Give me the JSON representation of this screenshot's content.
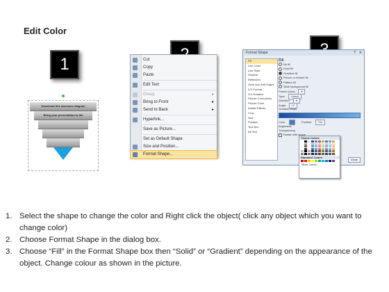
{
  "title": "Edit Color",
  "badges": [
    "1",
    "2",
    "3"
  ],
  "pyramid": {
    "layers": [
      "Download this awesome diagram",
      "Bring your presentation to life",
      "",
      "",
      ""
    ],
    "accent_color": "#1e9fe0"
  },
  "context_menu": {
    "items": [
      {
        "label": "Cut",
        "state": "normal"
      },
      {
        "label": "Copy",
        "state": "normal"
      },
      {
        "label": "Paste",
        "state": "normal"
      },
      {
        "label": "Edit Text",
        "state": "normal"
      },
      {
        "label": "Group",
        "state": "disabled"
      },
      {
        "label": "Bring to Front",
        "state": "normal",
        "submenu": true
      },
      {
        "label": "Send to Back",
        "state": "normal",
        "submenu": true
      },
      {
        "label": "Hyperlink...",
        "state": "normal"
      },
      {
        "label": "Save as Picture...",
        "state": "normal"
      },
      {
        "label": "Set as Default Shape",
        "state": "normal"
      },
      {
        "label": "Size and Position...",
        "state": "normal"
      },
      {
        "label": "Format Shape...",
        "state": "selected"
      }
    ]
  },
  "dialog": {
    "title": "Format Shape",
    "categories": [
      "Fill",
      "Line Color",
      "Line Style",
      "Shadow",
      "Reflection",
      "Glow and Soft Edges",
      "3-D Format",
      "3-D Rotation",
      "Picture Corrections",
      "Picture Color",
      "Artistic Effects",
      "Crop",
      "Size",
      "Position",
      "Text Box",
      "Alt Text"
    ],
    "selected_category": "Fill",
    "fill_heading": "Fill",
    "fill_options": [
      "No fill",
      "Solid fill",
      "Gradient fill",
      "Picture or texture fill",
      "Pattern fill",
      "Slide background fill"
    ],
    "selected_fill": "Gradient fill",
    "fields": [
      {
        "label": "Preset colors:",
        "value": ""
      },
      {
        "label": "Type:",
        "value": "Linear"
      },
      {
        "label": "Direction:",
        "value": ""
      },
      {
        "label": "Angle:",
        "value": "0°"
      }
    ],
    "gradient_stops_label": "Gradient stops",
    "color_label": "Color",
    "position_label": "Position:",
    "position_value": "0%",
    "brightness_label": "Brightness",
    "transparency_label": "Transparency",
    "rotate_label": "Rotate with shape",
    "close_label": "Close",
    "palette": {
      "theme_label": "Theme Colors",
      "standard_label": "Standard Colors",
      "more_label": "More Colors...",
      "theme_top": [
        "#ffffff",
        "#000000",
        "#eeece1",
        "#1f497d",
        "#4f81bd",
        "#c0504d",
        "#9bbb59",
        "#8064a2",
        "#4bacc6",
        "#f79646"
      ],
      "standard": [
        "#c00000",
        "#ff0000",
        "#ffc000",
        "#ffff00",
        "#92d050",
        "#00b050",
        "#00b0f0",
        "#0070c0",
        "#002060",
        "#7030a0"
      ]
    }
  },
  "instructions": [
    {
      "num": "1.",
      "text": "Select the shape to change the color and Right click the object( click any object which you want to change color)"
    },
    {
      "num": "2.",
      "text": "Choose Format Shape in the dialog box."
    },
    {
      "num": "3.",
      "text": "Choose “Fill” in the Format Shape box then “Solid” or “Gradient” depending on the appearance of the object. Change colour as shown in the picture."
    }
  ]
}
